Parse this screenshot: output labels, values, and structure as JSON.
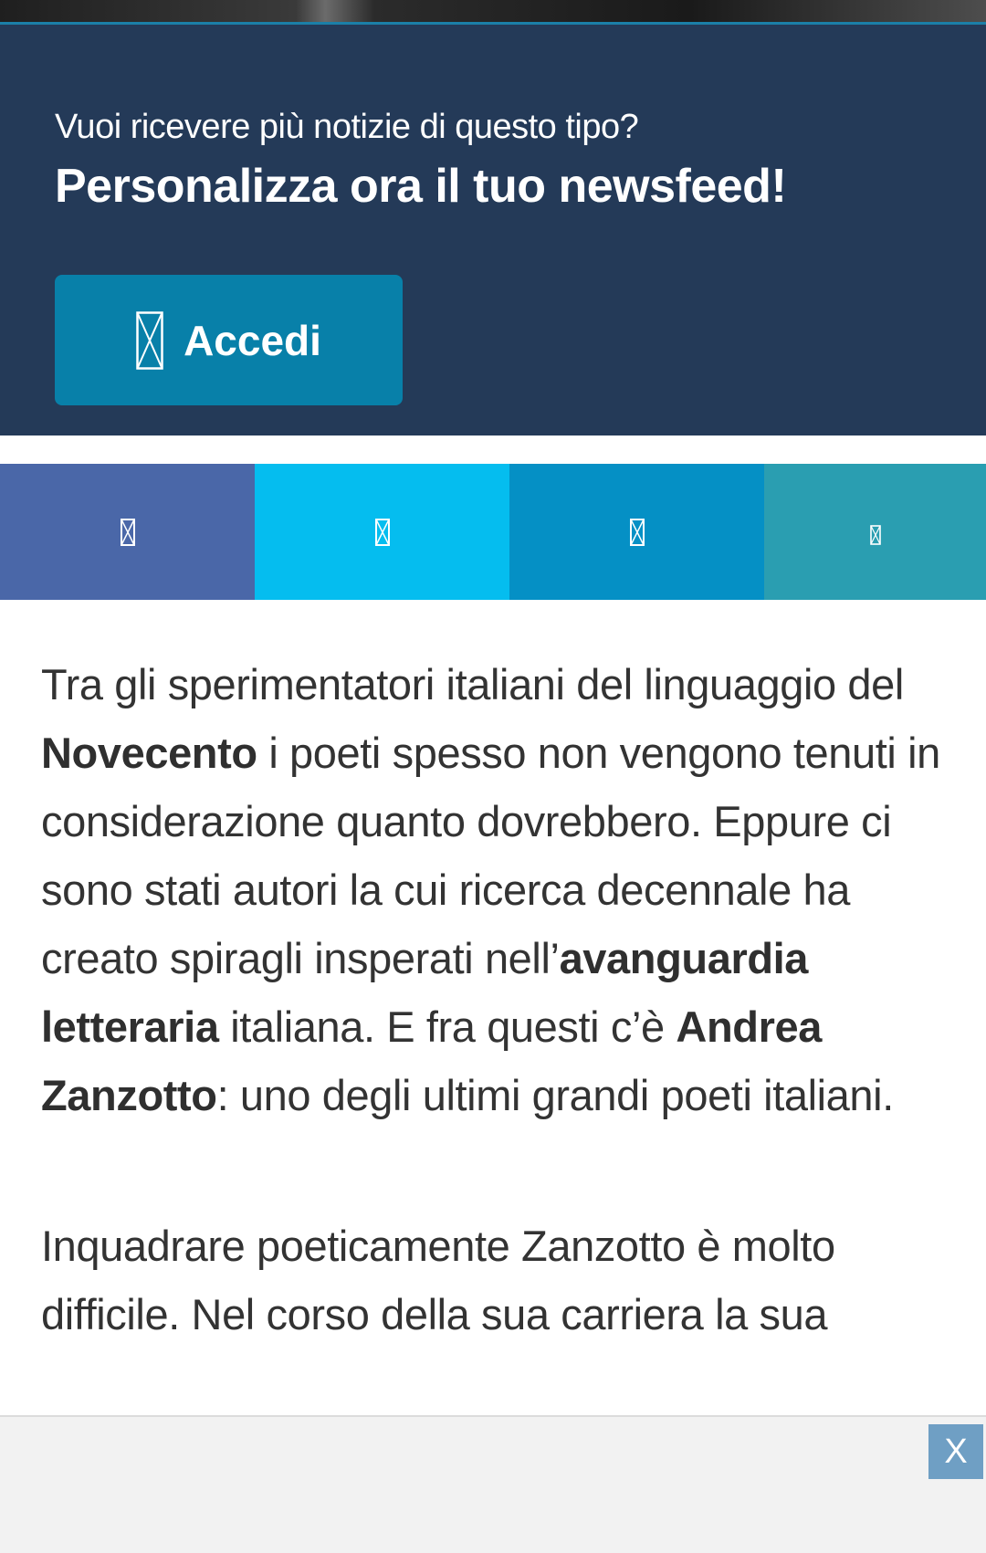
{
  "promo": {
    "question": "Vuoi ricevere più notizie di questo tipo?",
    "headline": "Personalizza ora il tuo newsfeed!",
    "login_label": "Accedi",
    "login_icon": "missing-glyph-icon"
  },
  "share": {
    "facebook_color": "#4a67a8",
    "twitter_color": "#05bdef",
    "linkedin_color": "#0590c5",
    "whatsapp_color": "#2a9eb1"
  },
  "article": {
    "p1": {
      "t1": "Tra gli sperimentatori italiani del linguaggio del ",
      "b1": "Novecento",
      "t2": " i poeti spesso non vengono tenuti in considerazione quanto dovrebbero. Eppure ci sono stati autori la cui ricerca decennale ha creato spiragli insperati nell’",
      "b2": "avanguardia letteraria",
      "t3": " italiana. E fra questi c’è ",
      "b3": "Andrea Zanzotto",
      "t4": ": uno degli ultimi grandi poeti italiani."
    },
    "p2": "Inquadrare poeticamente Zanzotto è molto difficile. Nel corso della sua carriera la sua"
  },
  "ad": {
    "close_label": "X"
  }
}
